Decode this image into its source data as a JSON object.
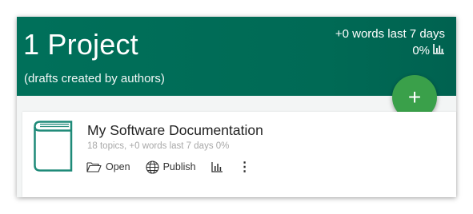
{
  "header": {
    "project_count": "1 Project",
    "subtitle": "(drafts created by authors)",
    "weekly_words": "+0 words last 7 days",
    "weekly_percent": "0%",
    "add_button": "+"
  },
  "project": {
    "title": "My Software Documentation",
    "meta": "18 topics, +0 words last 7 days 0%",
    "actions": {
      "open": "Open",
      "publish": "Publish",
      "more": "⋮"
    }
  },
  "colors": {
    "header": "#006a55",
    "fab": "#3aa04a",
    "book_outline": "#1e8a78"
  },
  "icons": [
    "bar-chart-icon",
    "book-icon",
    "folder-open-icon",
    "globe-icon",
    "more-vertical-icon"
  ]
}
